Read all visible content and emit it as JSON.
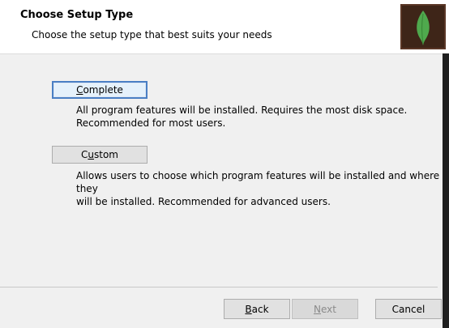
{
  "header": {
    "title": "Choose Setup Type",
    "subtitle": "Choose the setup type that best suits your needs",
    "logo_icon": "mongodb-leaf-icon"
  },
  "options": {
    "complete": {
      "label_mnemonic": "C",
      "label_rest": "omplete",
      "description_line1": "All program features will be installed. Requires the most disk space.",
      "description_line2": "Recommended for most users."
    },
    "custom": {
      "label_mnemonic": "u",
      "label_prefix": "C",
      "label_rest": "stom",
      "description_line1": "Allows users to choose which program features will be installed and where they",
      "description_line2": "will be installed. Recommended for advanced users."
    }
  },
  "footer": {
    "back": {
      "mnemonic": "B",
      "rest": "ack"
    },
    "next": {
      "mnemonic": "N",
      "rest": "ext",
      "enabled": false
    },
    "cancel_label": "Cancel"
  },
  "colors": {
    "leaf": "#4fa94d",
    "logo_bg": "#3e2518",
    "focus_border": "#4a7fc4"
  }
}
